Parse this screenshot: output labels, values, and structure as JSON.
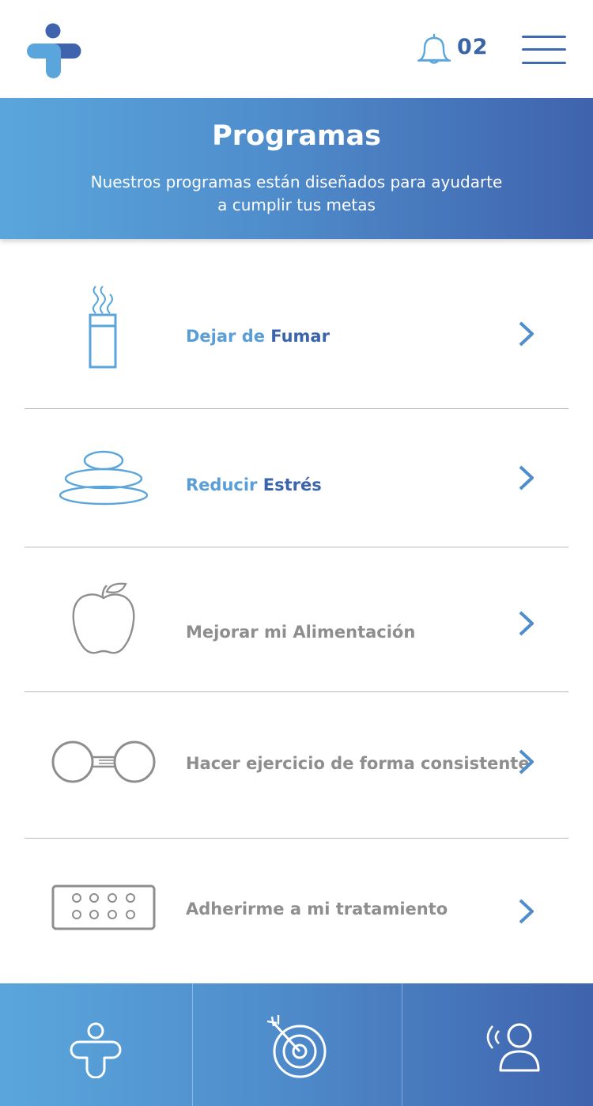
{
  "header": {
    "logo": "app-logo",
    "notifications": {
      "icon": "bell-icon",
      "count": "02"
    },
    "menu_icon": "hamburger-menu-icon"
  },
  "hero": {
    "title": "Programas",
    "subtitle_line1": "Nuestros programas están diseñados para ayudarte",
    "subtitle_line2": "a cumplir tus metas"
  },
  "programs": [
    {
      "icon": "cigarette-icon",
      "label_a": "Dejar de ",
      "label_b": "Fumar",
      "chevron": "chevron-right-icon"
    },
    {
      "icon": "stacked-stones-icon",
      "label_a": "Reducir ",
      "label_b": "Estrés",
      "chevron": "chevron-right-icon"
    },
    {
      "icon": "apple-icon",
      "label_a": "Mejorar mi Alimentación",
      "chevron": "chevron-right-icon"
    },
    {
      "icon": "dumbbell-icon",
      "label_a": "Hacer ejercicio de forma consistente",
      "chevron": "chevron-right-icon"
    },
    {
      "icon": "pill-pack-icon",
      "label_a": "Adherirme a mi tratamiento",
      "chevron": "chevron-right-icon"
    }
  ],
  "bottom_nav": [
    {
      "icon": "health-person-icon"
    },
    {
      "icon": "target-icon"
    },
    {
      "icon": "person-speaking-icon"
    }
  ],
  "colors": {
    "primary_light": "#5aa6dc",
    "primary_dark": "#3f63ad",
    "label_gray": "#8e8e8e"
  }
}
